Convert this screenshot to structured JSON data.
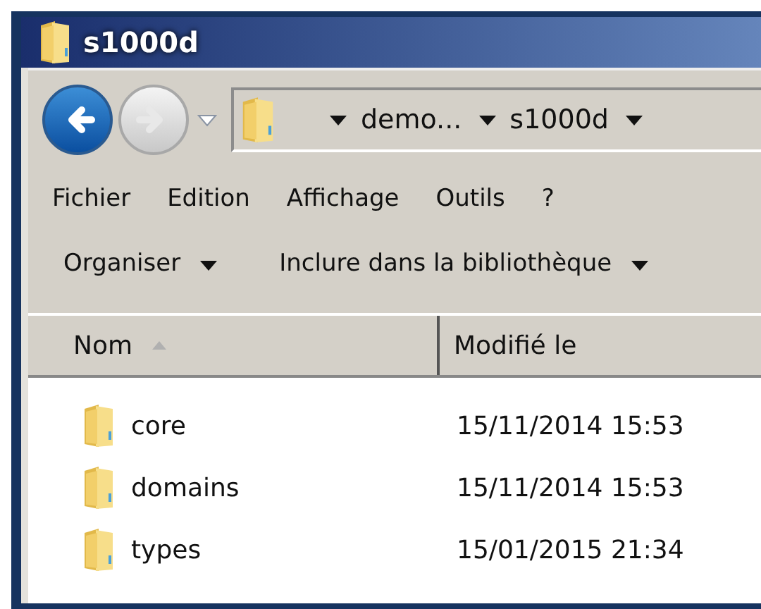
{
  "window": {
    "title": "s1000d"
  },
  "navigation": {
    "buttons": [
      {
        "kind": "back",
        "disabled": false
      },
      {
        "kind": "forward",
        "disabled": true
      }
    ],
    "breadcrumbs": [
      {
        "label": "demo..."
      },
      {
        "label": "s1000d"
      }
    ]
  },
  "menu_bar": [
    "Fichier",
    "Edition",
    "Affichage",
    "Outils",
    "?"
  ],
  "toolbar": [
    {
      "label": "Organiser"
    },
    {
      "label": "Inclure dans la bibliothèque"
    }
  ],
  "table": {
    "columns": [
      {
        "label": "Nom",
        "sorted": true
      },
      {
        "label": "Modifié le",
        "sorted": false
      }
    ],
    "rows": [
      {
        "name": "core",
        "modified": "15/11/2014 15:53"
      },
      {
        "name": "domains",
        "modified": "15/11/2014 15:53"
      },
      {
        "name": "types",
        "modified": "15/01/2015 21:34"
      }
    ]
  }
}
